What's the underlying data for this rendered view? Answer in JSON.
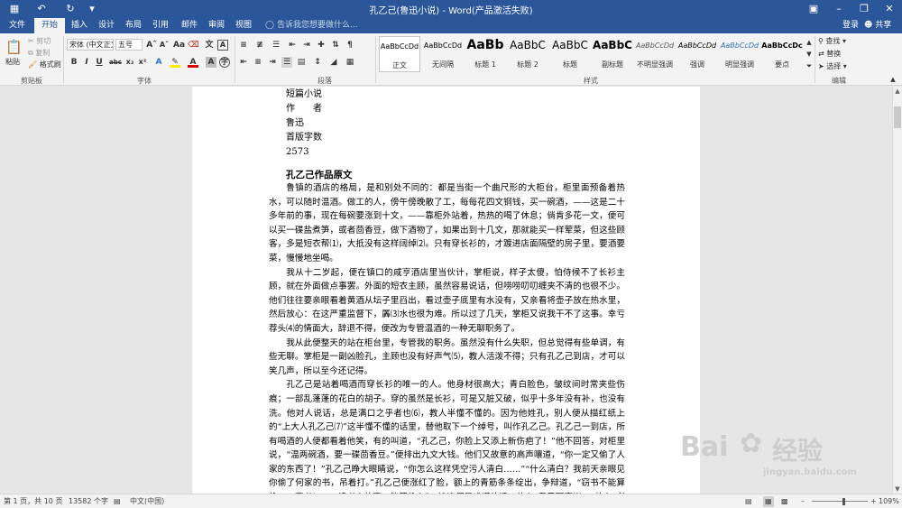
{
  "window": {
    "title": "孔乙己(鲁迅小说) - Word(产品激活失败)",
    "quick_access": [
      "save-icon",
      "undo-icon",
      "redo-icon",
      "customize-icon"
    ],
    "controls": [
      "ribbon-display-icon",
      "minimize-icon",
      "maximize-icon",
      "close-icon"
    ]
  },
  "tabs": {
    "items": [
      "文件",
      "开始",
      "插入",
      "设计",
      "布局",
      "引用",
      "邮件",
      "审阅",
      "视图"
    ],
    "active": "开始",
    "tell_me": "告诉我您想要做什么...",
    "login": "登录",
    "share": "共享"
  },
  "ribbon": {
    "clipboard": {
      "label": "剪贴板",
      "paste": "粘贴",
      "cut": "剪切",
      "copy": "复制",
      "format_painter": "格式刷"
    },
    "font": {
      "label": "字体",
      "font_name": "宋体 (中文正文)",
      "font_size": "五号",
      "buttons": [
        "B",
        "I",
        "U",
        "abc",
        "x₂",
        "x²"
      ]
    },
    "paragraph": {
      "label": "段落"
    },
    "styles": {
      "label": "样式",
      "items": [
        {
          "sample": "AaBbCcDd",
          "name": "正文"
        },
        {
          "sample": "AaBbCcDd",
          "name": "无间隔"
        },
        {
          "sample": "AaBb",
          "name": "标题 1"
        },
        {
          "sample": "AaBbC",
          "name": "标题 2"
        },
        {
          "sample": "AaBbC",
          "name": "标题"
        },
        {
          "sample": "AaBbC",
          "name": "副标题"
        },
        {
          "sample": "AaBbCcDd",
          "name": "不明显强调"
        },
        {
          "sample": "AaBbCcDd",
          "name": "强调"
        },
        {
          "sample": "AaBbCcDd",
          "name": "明显强调"
        },
        {
          "sample": "AaBbCcDc",
          "name": "要点"
        }
      ]
    },
    "editing": {
      "label": "编辑",
      "find": "查找",
      "replace": "替换",
      "select": "选择"
    }
  },
  "document": {
    "meta": [
      "短篇小说",
      "作　　者",
      "鲁迅",
      "首版字数",
      "2573"
    ],
    "heading": "孔乙己作品原文",
    "paragraphs": [
      "鲁镇的酒店的格局，是和别处不同的：都是当街一个曲尺形的大柜台，柜里面预备着热水，可以随时温酒。做工的人，傍午傍晚散了工，每每花四文铜钱，买一碗酒，——这是二十多年前的事，现在每碗要涨到十文，——靠柜外站着，热热的喝了休息；倘肯多花一文，便可以买一碟盐煮笋，或者茴香豆，做下酒物了，如果出到十几文，那就能买一样荤菜，但这些顾客，多是短衣帮⑴，大抵没有这样阔绰⑵。只有穿长衫的，才踱进店面隔壁的房子里，要酒要菜，慢慢地坐喝。",
      "我从十二岁起，便在镇口的咸亨酒店里当伙计，掌柜说，样子太傻，怕侍候不了长衫主顾，就在外面做点事罢。外面的短衣主顾，虽然容易说话，但唠唠叨叨缠夹不清的也很不少。他们往往要亲眼看着黄酒从坛子里舀出，看过壶子底里有水没有，又亲看将壶子放在热水里，然后放心：在这严重监督下，羼⑶水也很为难。所以过了几天，掌柜又说我干不了这事。幸亏荐头⑷的情面大，辞退不得，便改为专管温酒的一种无聊职务了。",
      "我从此便整天的站在柜台里，专管我的职务。虽然没有什么失职，但总觉得有些单调，有些无聊。掌柜是一副凶脸孔，主顾也没有好声气⑸，教人活泼不得；只有孔乙己到店，才可以笑几声，所以至今还记得。",
      "孔乙己是站着喝酒而穿长衫的唯一的人。他身材很高大；青白脸色，皱纹间时常夹些伤痕；一部乱蓬蓬的花白的胡子。穿的虽然是长衫，可是又脏又破，似乎十多年没有补，也没有洗。他对人说话，总是满口之乎者也⑹，教人半懂不懂的。因为他姓孔，别人便从描红纸上的“上大人孔乙己⑺”这半懂不懂的话里，替他取下一个绰号，叫作孔乙己。孔乙己一到店，所有喝酒的人便都看着他笑，有的叫道，“孔乙己，你脸上又添上新伤疤了！”他不回答，对柜里说，“温两碗酒，要一碟茴香豆。”便排出九文大钱。他们又故意的高声嚷道，“你一定又偷了人家的东西了！”孔乙己睁大眼睛说，“你怎么这样凭空污人清白……”“什么清白？我前天亲眼见你偷了何家的书，吊着打。”孔乙己便涨红了脸，额上的青筋条条绽出，争辩道，“窃书不能算偷……窃书！……读书人的事，能算偷么？”接连便是难懂的话，什么“君子固穷⑻”，什么“者乎”之类，引得众人都哄笑起来：店内外充满了快活的空气。"
    ]
  },
  "status": {
    "page": "第 1 页，共 10 页",
    "words": "13582 个字",
    "language": "中文(中国)",
    "zoom": "109%"
  },
  "watermark": {
    "brand": "Bai",
    "suffix": "经验",
    "url": "jingyan.baidu.com"
  }
}
